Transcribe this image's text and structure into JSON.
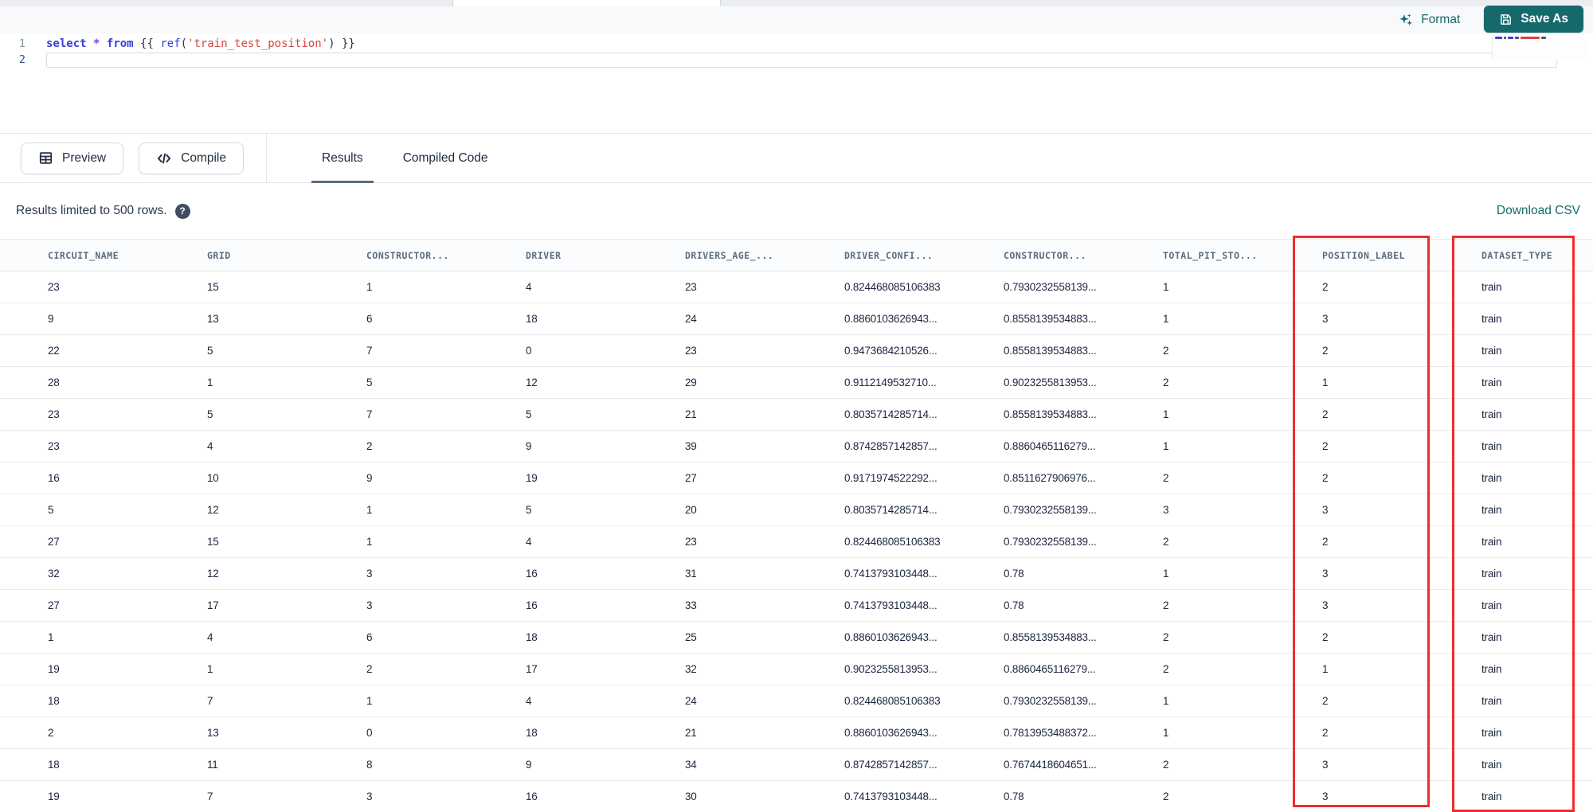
{
  "colors": {
    "teal": "#15696b",
    "highlight_red": "#ee2d2d"
  },
  "editor_toolbar": {
    "format_label": "Format",
    "save_as_label": "Save As"
  },
  "editor": {
    "lines": [
      {
        "number": "1",
        "current": false,
        "tokens": [
          {
            "text": "select",
            "type": "keyword"
          },
          {
            "text": " ",
            "type": "plain"
          },
          {
            "text": "*",
            "type": "operator"
          },
          {
            "text": " ",
            "type": "plain"
          },
          {
            "text": "from",
            "type": "keyword"
          },
          {
            "text": " ",
            "type": "plain"
          },
          {
            "text": "{{",
            "type": "punct"
          },
          {
            "text": " ",
            "type": "plain"
          },
          {
            "text": "ref",
            "type": "function"
          },
          {
            "text": "(",
            "type": "punct"
          },
          {
            "text": "'train_test_position'",
            "type": "string"
          },
          {
            "text": ")",
            "type": "punct"
          },
          {
            "text": " ",
            "type": "plain"
          },
          {
            "text": "}}",
            "type": "punct"
          }
        ]
      },
      {
        "number": "2",
        "current": true,
        "tokens": []
      }
    ]
  },
  "panel_toolbar": {
    "preview_label": "Preview",
    "compile_label": "Compile",
    "tabs": [
      {
        "label": "Results",
        "active": true
      },
      {
        "label": "Compiled Code",
        "active": false
      }
    ]
  },
  "results_bar": {
    "limit_text": "Results limited to 500 rows.",
    "help_glyph": "?",
    "download_label": "Download CSV"
  },
  "table": {
    "columns": [
      "CIRCUIT_NAME",
      "GRID",
      "CONSTRUCTOR...",
      "DRIVER",
      "DRIVERS_AGE_...",
      "DRIVER_CONFI...",
      "CONSTRUCTOR...",
      "TOTAL_PIT_STO...",
      "POSITION_LABEL",
      "DATASET_TYPE"
    ],
    "highlighted_columns": [
      "POSITION_LABEL",
      "DATASET_TYPE"
    ],
    "rows": [
      [
        "23",
        "15",
        "1",
        "4",
        "23",
        "0.824468085106383",
        "0.7930232558139...",
        "1",
        "2",
        "train"
      ],
      [
        "9",
        "13",
        "6",
        "18",
        "24",
        "0.8860103626943...",
        "0.8558139534883...",
        "1",
        "3",
        "train"
      ],
      [
        "22",
        "5",
        "7",
        "0",
        "23",
        "0.9473684210526...",
        "0.8558139534883...",
        "2",
        "2",
        "train"
      ],
      [
        "28",
        "1",
        "5",
        "12",
        "29",
        "0.9112149532710...",
        "0.9023255813953...",
        "2",
        "1",
        "train"
      ],
      [
        "23",
        "5",
        "7",
        "5",
        "21",
        "0.8035714285714...",
        "0.8558139534883...",
        "1",
        "2",
        "train"
      ],
      [
        "23",
        "4",
        "2",
        "9",
        "39",
        "0.8742857142857...",
        "0.8860465116279...",
        "1",
        "2",
        "train"
      ],
      [
        "16",
        "10",
        "9",
        "19",
        "27",
        "0.9171974522292...",
        "0.8511627906976...",
        "2",
        "2",
        "train"
      ],
      [
        "5",
        "12",
        "1",
        "5",
        "20",
        "0.8035714285714...",
        "0.7930232558139...",
        "3",
        "3",
        "train"
      ],
      [
        "27",
        "15",
        "1",
        "4",
        "23",
        "0.824468085106383",
        "0.7930232558139...",
        "2",
        "2",
        "train"
      ],
      [
        "32",
        "12",
        "3",
        "16",
        "31",
        "0.7413793103448...",
        "0.78",
        "1",
        "3",
        "train"
      ],
      [
        "27",
        "17",
        "3",
        "16",
        "33",
        "0.7413793103448...",
        "0.78",
        "2",
        "3",
        "train"
      ],
      [
        "1",
        "4",
        "6",
        "18",
        "25",
        "0.8860103626943...",
        "0.8558139534883...",
        "2",
        "2",
        "train"
      ],
      [
        "19",
        "1",
        "2",
        "17",
        "32",
        "0.9023255813953...",
        "0.8860465116279...",
        "2",
        "1",
        "train"
      ],
      [
        "18",
        "7",
        "1",
        "4",
        "24",
        "0.824468085106383",
        "0.7930232558139...",
        "1",
        "2",
        "train"
      ],
      [
        "2",
        "13",
        "0",
        "18",
        "21",
        "0.8860103626943...",
        "0.7813953488372...",
        "1",
        "2",
        "train"
      ],
      [
        "18",
        "11",
        "8",
        "9",
        "34",
        "0.8742857142857...",
        "0.7674418604651...",
        "2",
        "3",
        "train"
      ],
      [
        "19",
        "7",
        "3",
        "16",
        "30",
        "0.7413793103448...",
        "0.78",
        "2",
        "3",
        "train"
      ]
    ]
  }
}
